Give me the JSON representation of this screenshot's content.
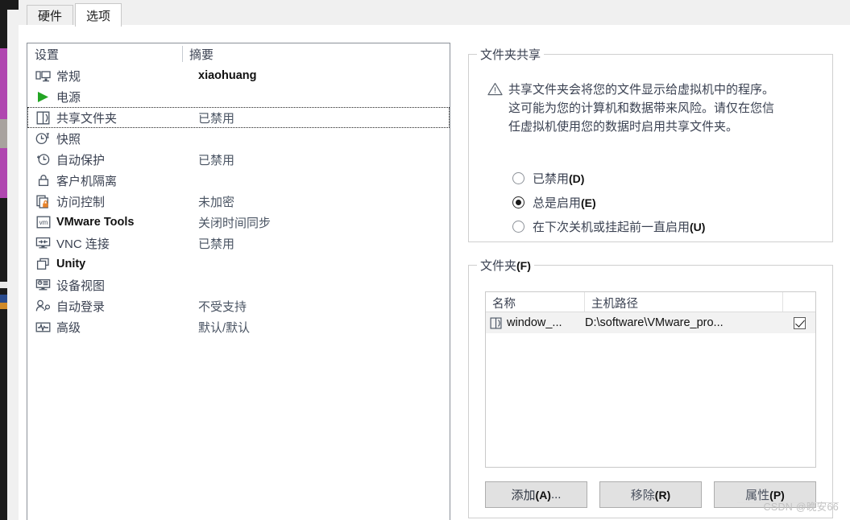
{
  "window": {
    "tabs": [
      {
        "label": "硬件",
        "active": false
      },
      {
        "label": "选项",
        "active": true
      }
    ]
  },
  "settings_list": {
    "columns": [
      "设置",
      "摘要"
    ],
    "rows": [
      {
        "icon": "monitor-icon",
        "label": "常规",
        "summary": "xiaohuang",
        "selected": false,
        "latin": false,
        "summary_strong": true
      },
      {
        "icon": "power-play-icon",
        "label": "电源",
        "summary": "",
        "selected": false,
        "latin": false,
        "summary_strong": false
      },
      {
        "icon": "shared-folder-icon",
        "label": "共享文件夹",
        "summary": "已禁用",
        "selected": true,
        "latin": false,
        "summary_strong": false
      },
      {
        "icon": "snapshot-clock-icon",
        "label": "快照",
        "summary": "",
        "selected": false,
        "latin": false,
        "summary_strong": false
      },
      {
        "icon": "autoprotect-icon",
        "label": "自动保护",
        "summary": "已禁用",
        "selected": false,
        "latin": false,
        "summary_strong": false
      },
      {
        "icon": "lock-icon",
        "label": "客户机隔离",
        "summary": "",
        "selected": false,
        "latin": false,
        "summary_strong": false
      },
      {
        "icon": "access-control-icon",
        "label": "访问控制",
        "summary": "未加密",
        "selected": false,
        "latin": false,
        "summary_strong": false
      },
      {
        "icon": "vmware-tools-icon",
        "label": "VMware Tools",
        "summary": "关闭时间同步",
        "selected": false,
        "latin": true,
        "summary_strong": false
      },
      {
        "icon": "vnc-icon",
        "label": "VNC 连接",
        "summary": "已禁用",
        "selected": false,
        "latin": false,
        "summary_strong": false
      },
      {
        "icon": "unity-icon",
        "label": "Unity",
        "summary": "",
        "selected": false,
        "latin": true,
        "summary_strong": false
      },
      {
        "icon": "device-view-icon",
        "label": "设备视图",
        "summary": "",
        "selected": false,
        "latin": false,
        "summary_strong": false
      },
      {
        "icon": "auto-login-icon",
        "label": "自动登录",
        "summary": "不受支持",
        "selected": false,
        "latin": false,
        "summary_strong": false
      },
      {
        "icon": "advanced-icon",
        "label": "高级",
        "summary": "默认/默认",
        "selected": false,
        "latin": false,
        "summary_strong": false
      }
    ]
  },
  "folder_sharing": {
    "legend": "文件夹共享",
    "warning_text": "共享文件夹会将您的文件显示给虚拟机中的程序。这可能为您的计算机和数据带来风险。请仅在您信任虚拟机使用您的数据时启用共享文件夹。",
    "options": [
      {
        "label": "已禁用",
        "accel": "(D)",
        "selected": false
      },
      {
        "label": "总是启用",
        "accel": "(E)",
        "selected": true
      },
      {
        "label": "在下次关机或挂起前一直启用",
        "accel": "(U)",
        "selected": false
      }
    ]
  },
  "folders": {
    "legend": "文件夹",
    "legend_accel": "(F)",
    "columns": [
      "名称",
      "主机路径",
      ""
    ],
    "rows": [
      {
        "name": "window_...",
        "host_path": "D:\\software\\VMware_pro...",
        "enabled": true
      }
    ],
    "buttons": [
      {
        "label": "添加",
        "accel": "(A)",
        "suffix": "...",
        "enabled": true
      },
      {
        "label": "移除",
        "accel": "(R)",
        "suffix": "",
        "enabled": false
      },
      {
        "label": "属性",
        "accel": "(P)",
        "suffix": "",
        "enabled": false
      }
    ]
  },
  "watermark": {
    "text": "CSDN @晚安66"
  },
  "colors": {
    "accent_green": "#23a524",
    "accent_orange": "#e8832a",
    "icon_stroke": "#4a5463",
    "selection_bg": "#f2f2f2",
    "button_face": "#e1e1e1"
  }
}
